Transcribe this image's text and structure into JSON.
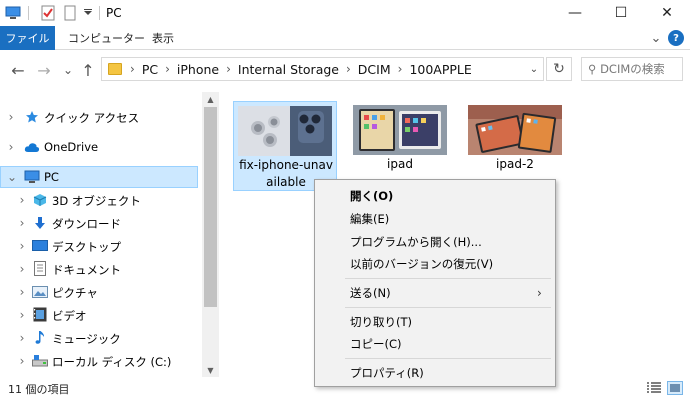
{
  "window": {
    "title": "PC",
    "controls": {
      "minimize": "—",
      "maximize": "☐",
      "close": "✕"
    }
  },
  "ribbon": {
    "file_tab": "ファイル",
    "tabs": [
      "コンピューター",
      "表示"
    ],
    "collapse": "⌄",
    "help": "?"
  },
  "nav_buttons": {
    "back": "←",
    "forward": "→",
    "recent": "⌄",
    "up": "↑"
  },
  "address": {
    "crumbs": [
      "PC",
      "iPhone",
      "Internal Storage",
      "DCIM",
      "100APPLE"
    ],
    "separator": "›",
    "dropdown": "⌄",
    "refresh": "↻"
  },
  "search": {
    "placeholder": "⚲ DCIMの検索"
  },
  "nav_pane": {
    "items": [
      {
        "label": "クイック アクセス",
        "icon": "star-icon"
      },
      {
        "label": "OneDrive",
        "icon": "cloud-icon"
      },
      {
        "label": "PC",
        "icon": "pc-icon",
        "expanded": true,
        "selected": true
      },
      {
        "label": "3D オブジェクト",
        "icon": "cube-icon"
      },
      {
        "label": "ダウンロード",
        "icon": "download-icon"
      },
      {
        "label": "デスクトップ",
        "icon": "desktop-icon"
      },
      {
        "label": "ドキュメント",
        "icon": "document-icon"
      },
      {
        "label": "ピクチャ",
        "icon": "picture-icon"
      },
      {
        "label": "ビデオ",
        "icon": "video-icon"
      },
      {
        "label": "ミュージック",
        "icon": "music-icon"
      },
      {
        "label": "ローカル ディスク (C:)",
        "icon": "drive-icon"
      }
    ],
    "chevron_collapsed": "›",
    "chevron_expanded": "⌄"
  },
  "files": [
    {
      "name_line1": "fix-iphone-unav",
      "name_line2": "ailable",
      "selected": true
    },
    {
      "name_line1": "ipad",
      "name_line2": ""
    },
    {
      "name_line1": "ipad-2",
      "name_line2": ""
    }
  ],
  "status": {
    "text": "11 個の項目"
  },
  "context_menu": {
    "items": [
      {
        "label": "開く(O)",
        "bold": true
      },
      {
        "label": "編集(E)"
      },
      {
        "label": "プログラムから開く(H)..."
      },
      {
        "label": "以前のバージョンの復元(V)"
      },
      {
        "label": "送る(N)",
        "submenu": "›"
      },
      {
        "label": "切り取り(T)"
      },
      {
        "label": "コピー(C)"
      },
      {
        "label": "プロパティ(R)"
      }
    ]
  },
  "colors": {
    "accent": "#1a6fc1",
    "selection": "#cce8ff",
    "selection_border": "#99d1ff"
  }
}
